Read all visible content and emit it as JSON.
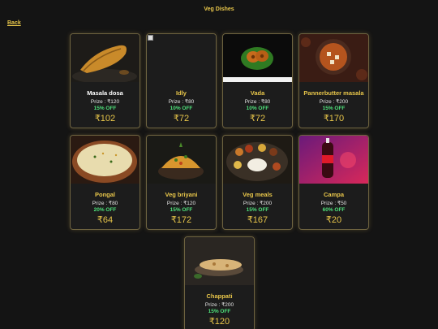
{
  "header": {
    "title": "Veg Dishes",
    "back_label": "Back"
  },
  "colors": {
    "accent": "#e8c64a",
    "discount": "#4ee07a",
    "background": "#141414",
    "card_border": "#6e6340"
  },
  "dishes": [
    {
      "name": "Masala dosa",
      "price": "Prize : ₹120",
      "discount": "15% OFF",
      "final": "₹102",
      "image": "masala-dosa-image"
    },
    {
      "name": "Idly",
      "price": "Prize : ₹80",
      "discount": "10% OFF",
      "final": "₹72",
      "image": "broken-image-icon"
    },
    {
      "name": "Vada",
      "price": "Prize : ₹80",
      "discount": "10% OFF",
      "final": "₹72",
      "image": "vada-image"
    },
    {
      "name": "Pannerbutter masala",
      "price": "Prize : ₹200",
      "discount": "15% OFF",
      "final": "₹170",
      "image": "paneer-butter-masala-image"
    },
    {
      "name": "Pongal",
      "price": "Prize : ₹80",
      "discount": "20% OFF",
      "final": "₹64",
      "image": "pongal-image"
    },
    {
      "name": "Veg briyani",
      "price": "Prize : ₹120",
      "discount": "15% OFF",
      "final": "₹172",
      "image": "veg-briyani-image"
    },
    {
      "name": "Veg meals",
      "price": "Prize : ₹200",
      "discount": "15% OFF",
      "final": "₹167",
      "image": "veg-meals-image"
    },
    {
      "name": "Campa",
      "price": "Prize : ₹50",
      "discount": "60% OFF",
      "final": "₹20",
      "image": "campa-image"
    },
    {
      "name": "Chappati",
      "price": "Prize : ₹200",
      "discount": "15% OFF",
      "final": "₹120",
      "image": "chappati-image"
    }
  ]
}
